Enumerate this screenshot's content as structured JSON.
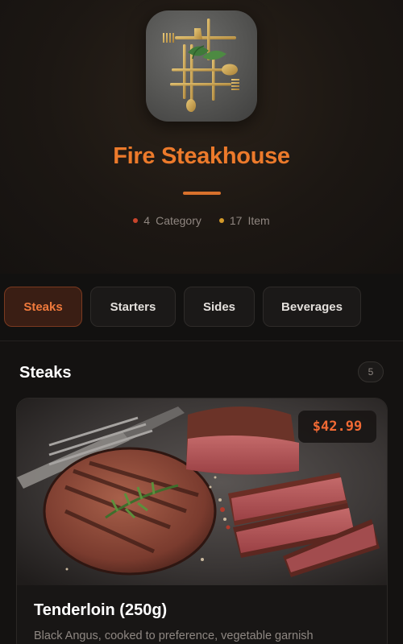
{
  "restaurant": {
    "name": "Fire Steakhouse",
    "stats": [
      {
        "value": "4",
        "label": "Category"
      },
      {
        "value": "17",
        "label": "Item"
      }
    ]
  },
  "tabs": [
    {
      "label": "Steaks",
      "active": true
    },
    {
      "label": "Starters",
      "active": false
    },
    {
      "label": "Sides",
      "active": false
    },
    {
      "label": "Beverages",
      "active": false
    }
  ],
  "section": {
    "title": "Steaks",
    "count": "5"
  },
  "items": [
    {
      "name": "Tenderloin (250g)",
      "description": "Black Angus, cooked to preference, vegetable garnish",
      "price": "$42.99"
    }
  ],
  "colors": {
    "accent": "#ec7a2b",
    "background": "#141211",
    "price": "#f26a34"
  },
  "icons": {
    "logo": "gold-cutlery-logo",
    "food_photo": "steak-photo"
  }
}
